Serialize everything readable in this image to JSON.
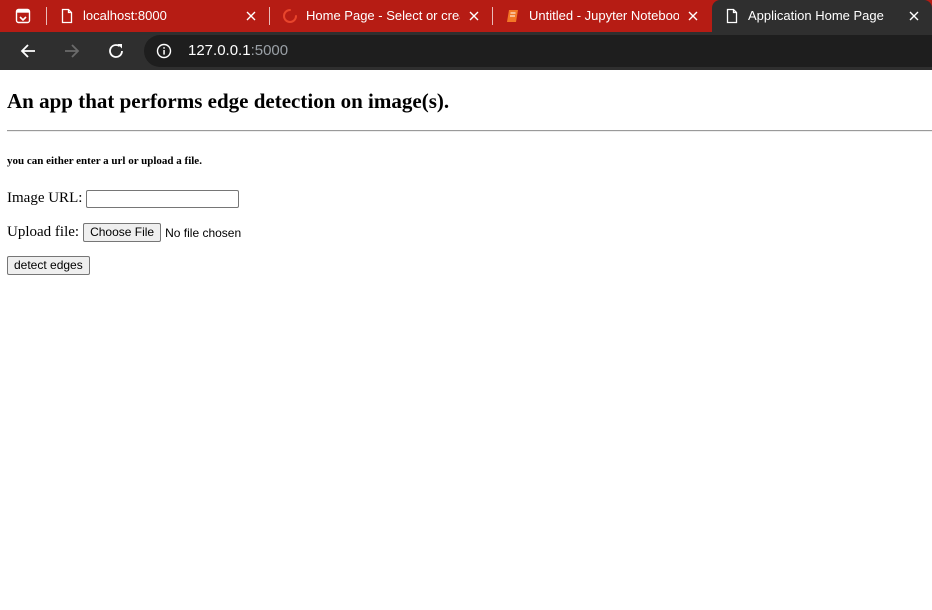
{
  "browser": {
    "tabs": [
      {
        "title": "localhost:8000",
        "icon": "page-icon",
        "active": false
      },
      {
        "title": "Home Page - Select or create",
        "icon": "loading-spinner-icon",
        "active": false
      },
      {
        "title": "Untitled - Jupyter Notebook",
        "icon": "notebook-icon",
        "active": false
      },
      {
        "title": "Application Home Page",
        "icon": "page-icon",
        "active": true
      }
    ],
    "address_host": "127.0.0.1",
    "address_port": ":5000",
    "colors": {
      "tab_strip": "#b61c14",
      "toolbar": "#2f2f2f",
      "omnibox": "#1e1e1e"
    }
  },
  "page": {
    "heading": "An app that performs edge detection on image(s).",
    "subheading": "you can either enter a url or upload a file.",
    "url_label": "Image URL:",
    "url_value": "",
    "file_label": "Upload file:",
    "choose_button": "Choose File",
    "file_status": "No file chosen",
    "submit_button": "detect edges"
  }
}
